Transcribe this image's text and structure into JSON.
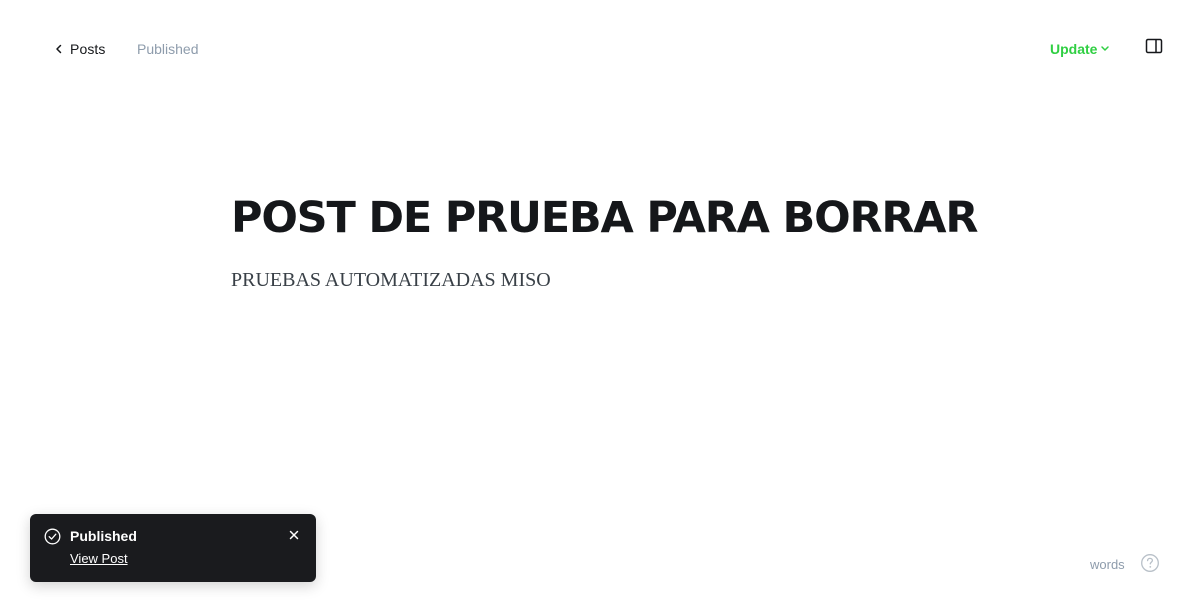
{
  "header": {
    "back_label": "Posts",
    "status": "Published",
    "update_label": "Update"
  },
  "post": {
    "title": "POST DE PRUEBA PARA BORRAR",
    "excerpt": "PRUEBAS AUTOMATIZADAS MISO"
  },
  "toast": {
    "title": "Published",
    "link_label": "View Post"
  },
  "footer": {
    "word_count_label": "words"
  },
  "colors": {
    "accent_green": "#30cf43",
    "toast_background": "#1a1b1e",
    "muted_text": "#8e9cac",
    "title_text": "#15171a"
  },
  "icons": {
    "back": "chevron-left-icon",
    "update_dropdown": "chevron-down-icon",
    "sidebar": "sidebar-panel-icon",
    "toast_status": "check-circle-icon",
    "toast_close": "close-icon",
    "help": "question-circle-icon"
  }
}
